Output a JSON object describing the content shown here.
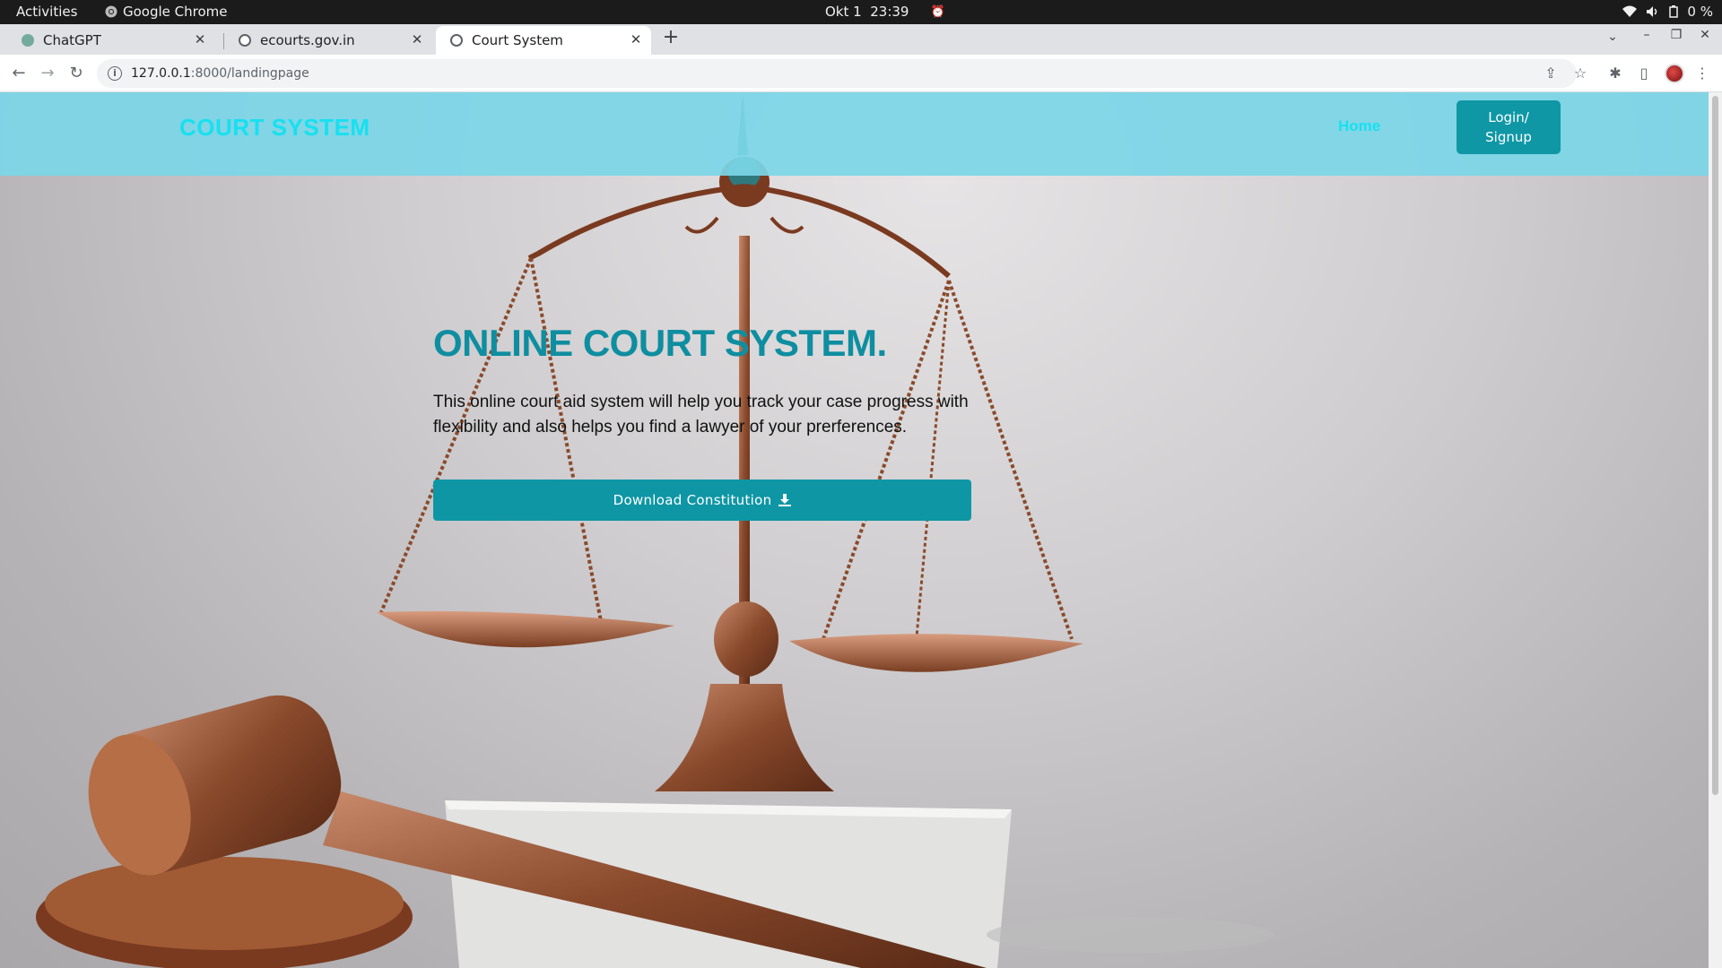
{
  "os_bar": {
    "activities": "Activities",
    "app_name": "Google Chrome",
    "date": "Okt 1",
    "time": "23:39",
    "battery": "0 %"
  },
  "browser": {
    "tabs": [
      {
        "title": "ChatGPT",
        "active": false,
        "favicon_color": "#74aa9c"
      },
      {
        "title": "ecourts.gov.in",
        "active": false,
        "favicon_color": "#5f6368"
      },
      {
        "title": "Court System",
        "active": true,
        "favicon_color": "#5f6368"
      }
    ],
    "url_host": "127.0.0.1",
    "url_path": ":8000/landingpage"
  },
  "page": {
    "brand": "COURT SYSTEM",
    "nav": {
      "home": "Home",
      "login_line1": "Login/",
      "login_line2": "Signup"
    },
    "headline": "ONLINE COURT SYSTEM.",
    "lead": "This online court aid system will help you track your case progress with flexibility and also helps you find a lawyer of your prerferences.",
    "download_button": "Download Constitution"
  },
  "colors": {
    "navbar": "#7bd6e7",
    "brand_text": "#17e0f0",
    "accent": "#0f96a5",
    "headline": "#0e8ea0"
  }
}
